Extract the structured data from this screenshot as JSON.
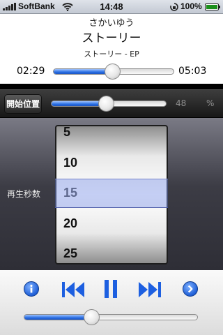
{
  "status_bar": {
    "carrier": "SoftBank",
    "time": "14:48",
    "battery_percent": "100%"
  },
  "now_playing": {
    "artist": "さかいゆう",
    "title": "ストーリー",
    "album": "ストーリー - EP",
    "elapsed": "02:29",
    "remaining": "05:03",
    "progress_fraction": 0.49
  },
  "start_position": {
    "button_label": "開始位置",
    "value": "48",
    "unit": "%",
    "fraction": 0.48
  },
  "playback_seconds": {
    "label": "再生秒数",
    "options": [
      "5",
      "10",
      "15",
      "20",
      "25"
    ],
    "selected": "15"
  },
  "controls": {
    "info_icon": "info-circle-icon",
    "previous_icon": "skip-back-icon",
    "pause_icon": "pause-icon",
    "next_icon": "skip-forward-icon",
    "more_icon": "chevron-right-circle-icon",
    "volume_fraction": 0.39
  },
  "colors": {
    "accent_blue": "#2a6fe3",
    "icon_blue": "#1d5fe0"
  }
}
